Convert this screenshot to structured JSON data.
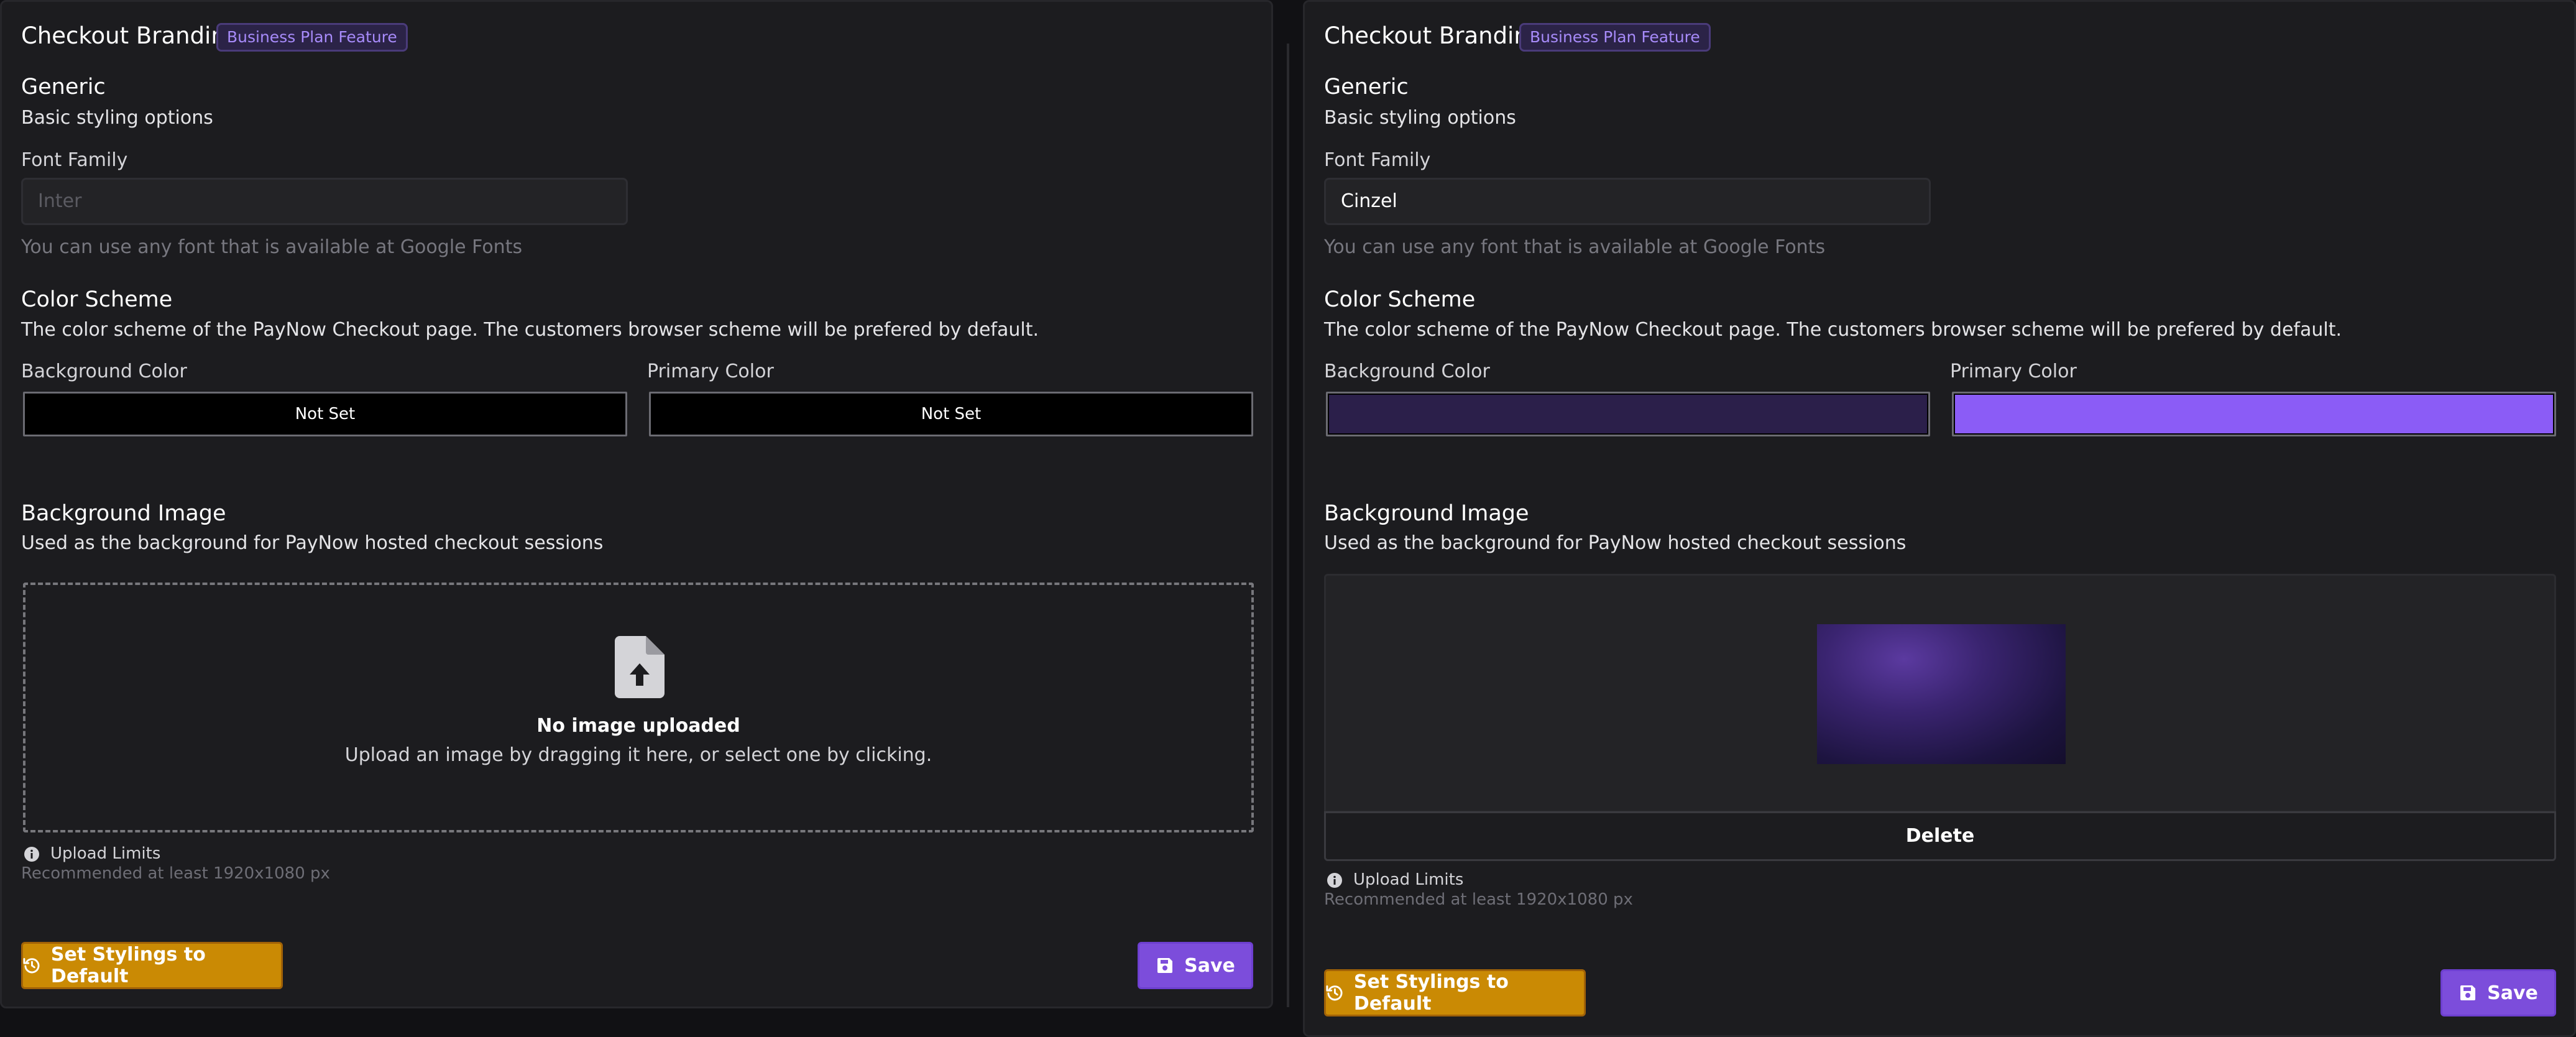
{
  "colors": {
    "badge_text": "#a78bfa",
    "default_button": "#ca8a04",
    "save_button": "#7c4ddb"
  },
  "panels": [
    {
      "title": "Checkout Branding",
      "badge": "Business Plan Feature",
      "generic_heading": "Generic",
      "generic_subtitle": "Basic styling options",
      "font_family_label": "Font Family",
      "font_family_value": "",
      "font_family_placeholder": "Inter",
      "font_family_hint": "You can use any font that is available at Google Fonts",
      "color_scheme_heading": "Color Scheme",
      "color_scheme_subtitle": "The color scheme of the PayNow Checkout page. The customers browser scheme will be prefered by default.",
      "background_color_label": "Background Color",
      "background_color_value": "Not Set",
      "background_color_swatch": "#000000",
      "primary_color_label": "Primary Color",
      "primary_color_value": "Not Set",
      "primary_color_swatch": "#000000",
      "background_image_heading": "Background Image",
      "background_image_subtitle": "Used as the background for PayNow hosted checkout sessions",
      "dropzone_icon": "file-upload-icon",
      "dropzone_title": "No image uploaded",
      "dropzone_subtitle": "Upload an image by dragging it here, or select one by clicking.",
      "upload_limits_label": "Upload Limits",
      "upload_limits_hint": "Recommended at least 1920x1080 px",
      "default_button_label": "Set Stylings to Default",
      "save_button_label": "Save"
    },
    {
      "title": "Checkout Branding",
      "badge": "Business Plan Feature",
      "generic_heading": "Generic",
      "generic_subtitle": "Basic styling options",
      "font_family_label": "Font Family",
      "font_family_value": "Cinzel",
      "font_family_hint": "You can use any font that is available at Google Fonts",
      "color_scheme_heading": "Color Scheme",
      "color_scheme_subtitle": "The color scheme of the PayNow Checkout page. The customers browser scheme will be prefered by default.",
      "background_color_label": "Background Color",
      "background_color_swatch": "#2b1f4a",
      "primary_color_label": "Primary Color",
      "primary_color_swatch": "#8b5cf6",
      "background_image_heading": "Background Image",
      "background_image_subtitle": "Used as the background for PayNow hosted checkout sessions",
      "delete_button_label": "Delete",
      "upload_limits_label": "Upload Limits",
      "upload_limits_hint": "Recommended at least 1920x1080 px",
      "default_button_label": "Set Stylings to Default",
      "save_button_label": "Save"
    }
  ]
}
